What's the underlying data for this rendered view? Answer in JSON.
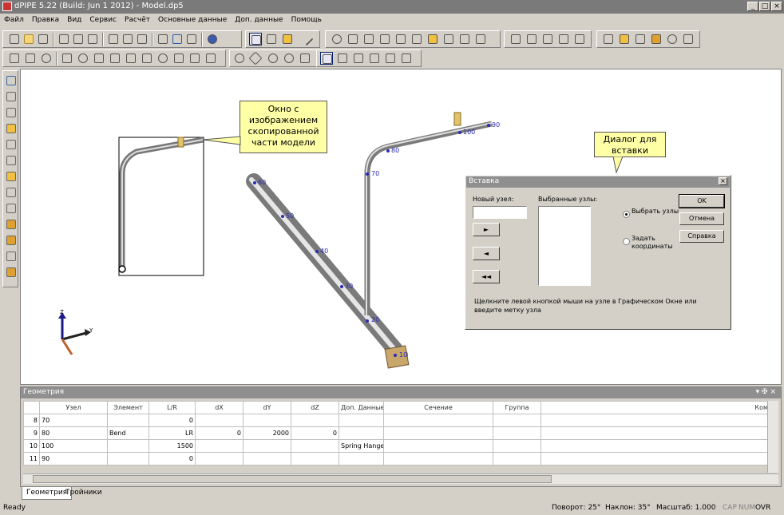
{
  "window": {
    "title": "dPIPE 5.22 (Build: Jun  1 2012) - Model.dp5",
    "minimize": "_",
    "maximize": "□",
    "close": "×"
  },
  "menu": [
    "Файл",
    "Правка",
    "Вид",
    "Сервис",
    "Расчёт",
    "Основные данные",
    "Доп. данные",
    "Помощь"
  ],
  "callouts": {
    "copied": "Окно с изображением скопированной части модели",
    "dialog": "Диалог для вставки"
  },
  "nodes": {
    "n10": "10",
    "n20": "20",
    "n30": "30",
    "n40": "40",
    "n50": "50",
    "n60": "60",
    "n70": "70",
    "n80": "80",
    "n90": "90",
    "n100": "100"
  },
  "axes": {
    "z": "Z",
    "y": "Y"
  },
  "dialog": {
    "title": "Вставка",
    "close": "×",
    "new_node_label": "Новый узел:",
    "new_node_value": "",
    "selected_nodes_label": "Выбранные узлы:",
    "btn_next": "►",
    "btn_prev": "◄",
    "btn_first": "◄◄",
    "radio_select": "Выбрать узлы",
    "radio_coords": "Задать координаты",
    "ok": "OK",
    "cancel": "Отмена",
    "help": "Справка",
    "hint": "Щелкните левой кнопкой мыши на узле в Графическом Окне или введите метку узла"
  },
  "geometry": {
    "title": "Геометрия",
    "controls": "▾ ✠ ×",
    "columns": [
      "",
      "Узел",
      "Элемент",
      "L/R",
      "dX",
      "dY",
      "dZ",
      "Доп. Данные",
      "Сечение",
      "Группа",
      "Ком"
    ],
    "rows": [
      [
        "8",
        "70",
        "",
        "0",
        "",
        "",
        "",
        "",
        "",
        "",
        ""
      ],
      [
        "9",
        "80",
        "Bend",
        "LR",
        "0",
        "2000",
        "0",
        "",
        "",
        "",
        ""
      ],
      [
        "10",
        "100",
        "",
        "1500",
        "",
        "",
        "",
        "Spring Hanger",
        "",
        "",
        ""
      ],
      [
        "11",
        "90",
        "",
        "0",
        "",
        "",
        "",
        "",
        "",
        "",
        ""
      ]
    ]
  },
  "tabs": [
    "Геометрия",
    "Тройники"
  ],
  "status": {
    "ready": "Ready",
    "rotation": "Поворот: 25°",
    "tilt": "Наклон: 35°",
    "scale": "Масштаб: 1.000",
    "cap": "CAP",
    "num": "NUM",
    "ovr": "OVR"
  }
}
